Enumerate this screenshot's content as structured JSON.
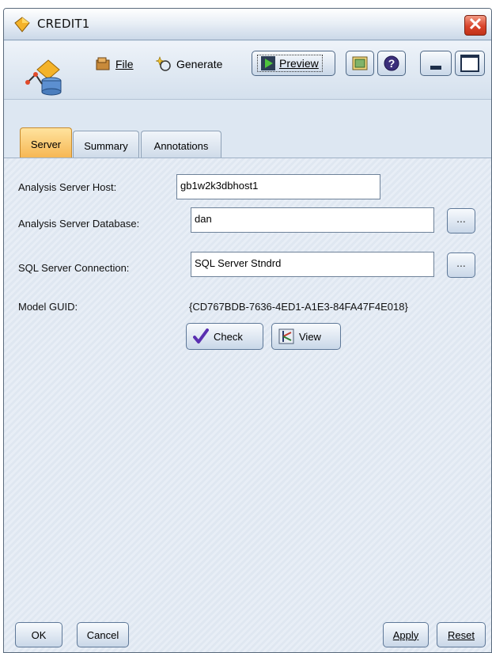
{
  "window": {
    "title": "CREDIT1",
    "close_glyph": "✕"
  },
  "toolbar": {
    "file_label": "File",
    "generate_label": "Generate",
    "preview_label": "Preview",
    "help_glyph": "?"
  },
  "tabs": [
    {
      "label": "Server",
      "active": true
    },
    {
      "label": "Summary",
      "active": false
    },
    {
      "label": "Annotations",
      "active": false
    }
  ],
  "form": {
    "host_label": "Analysis Server Host:",
    "host_value": "gb1w2k3dbhost1",
    "database_label": "Analysis Server Database:",
    "database_value": "dan",
    "sql_label": "SQL Server Connection:",
    "sql_value": "SQL Server Stndrd",
    "guid_label": "Model GUID:",
    "guid_value": "{CD767BDB-7636-4ED1-A1E3-84FA47F4E018}",
    "browse_label": "...",
    "check_label": "Check",
    "view_label": "View"
  },
  "footer": {
    "ok_label": "OK",
    "cancel_label": "Cancel",
    "apply_label": "Apply",
    "reset_label": "Reset"
  },
  "colors": {
    "active_tab": "#f6b652",
    "panel_bg": "#e8eef6",
    "accent": "#4e6785"
  }
}
